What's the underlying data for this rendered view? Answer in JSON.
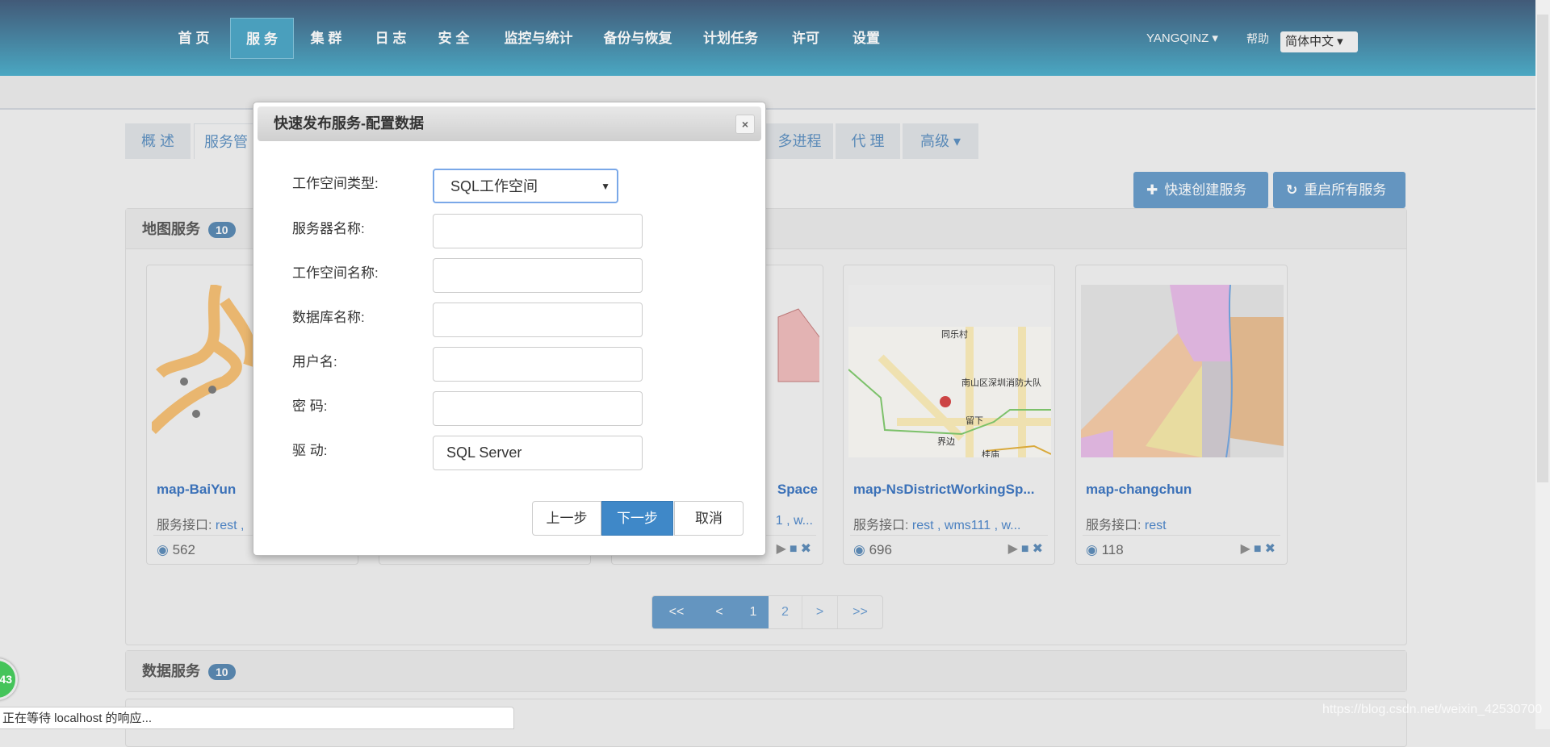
{
  "nav": {
    "items": [
      "首 页",
      "服 务",
      "集 群",
      "日 志",
      "安 全",
      "监控与统计",
      "备份与恢复",
      "计划任务",
      "许可",
      "设置"
    ],
    "active": 1,
    "user": "YANGQINZ ▾",
    "help": "帮助",
    "language": "简体中文 ▾"
  },
  "tabs": [
    "概 述",
    "服务管",
    "多进程",
    "代 理",
    "高级 ▾"
  ],
  "actions": {
    "quick_create": "快速创建服务",
    "restart_all": "重启所有服务",
    "plus_icon": "plus-icon",
    "refresh_icon": "refresh-icon"
  },
  "map_panel": {
    "title": "地图服务",
    "count": "10",
    "cards": [
      {
        "name": "map-BaiYun",
        "if_label": "服务接口:",
        "interfaces": "rest ,",
        "views": "562"
      },
      {
        "name": "",
        "if_label": "",
        "interfaces": "",
        "views": ""
      },
      {
        "name": "Space",
        "if_label": "",
        "interfaces": "1 , w...",
        "views": ""
      },
      {
        "name": "map-NsDistrictWorkingSp...",
        "if_label": "服务接口:",
        "interfaces": "rest , wms111 , w...",
        "views": "696"
      },
      {
        "name": "map-changchun",
        "if_label": "服务接口:",
        "interfaces": "rest",
        "views": "118"
      }
    ]
  },
  "pagination": [
    "<<",
    "<",
    "1",
    "2",
    ">",
    ">>"
  ],
  "data_panel": {
    "title": "数据服务",
    "count": "10"
  },
  "modal": {
    "title": "快速发布服务-配置数据",
    "close": "×",
    "fields": [
      {
        "label": "工作空间类型:",
        "value": "SQL工作空间",
        "type": "select"
      },
      {
        "label": "服务器名称:",
        "value": ""
      },
      {
        "label": "工作空间名称:",
        "value": ""
      },
      {
        "label": "数据库名称:",
        "value": ""
      },
      {
        "label": "用户名:",
        "value": ""
      },
      {
        "label": "密 码:",
        "value": ""
      },
      {
        "label": "驱 动:",
        "value": "SQL Server"
      }
    ],
    "prev": "上一步",
    "next": "下一步",
    "cancel": "取消"
  },
  "status_text": "正在等待 localhost 的响应...",
  "float_badge": "43",
  "watermark": "https://blog.csdn.net/weixin_42530700",
  "colors": {
    "accent": "#6495c0",
    "primary_button": "#3f88c8",
    "link": "#3b71b8"
  }
}
